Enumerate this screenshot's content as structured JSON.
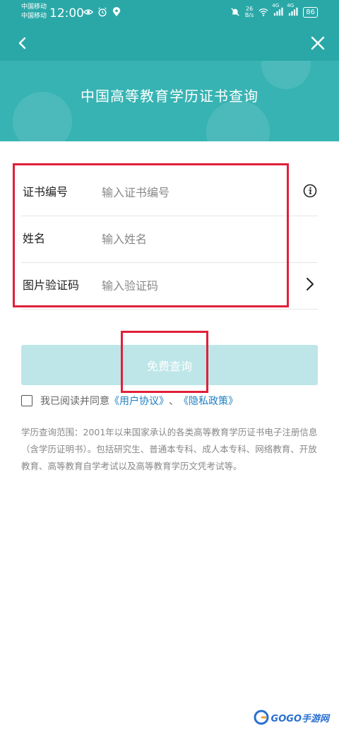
{
  "status_bar": {
    "carrier_1": "中国移动",
    "carrier_2": "中国移动",
    "time": "12:00",
    "net_speed_value": "26",
    "net_speed_unit": "B/s",
    "signal_1_label": "4G",
    "signal_2_label": "4G",
    "battery": "86"
  },
  "header": {
    "title": "中国高等教育学历证书查询"
  },
  "form": {
    "fields": [
      {
        "label": "证书编号",
        "placeholder": "输入证书编号"
      },
      {
        "label": "姓名",
        "placeholder": "输入姓名"
      },
      {
        "label": "图片验证码",
        "placeholder": "输入验证码"
      }
    ]
  },
  "query_button": {
    "label": "免费查询"
  },
  "agreement": {
    "prefix": "我已阅读并同意",
    "user_agreement": "《用户协议》",
    "separator": "、",
    "privacy_policy": "《隐私政策》",
    "checked": false
  },
  "description": "学历查询范围：2001年以来国家承认的各类高等教育学历证书电子注册信息（含学历证明书）。包括研究生、普通本专科、成人本专科、网络教育、开放教育、高等教育自学考试以及高等教育学历文凭考试等。",
  "watermark": {
    "text": "GOGO手游网"
  },
  "colors": {
    "header_teal": "#2aa8a8",
    "button_disabled": "#bee6e8",
    "link_blue": "#1e7fc2",
    "annotation_red": "#e0203a"
  },
  "icons": [
    "chevron-left-icon",
    "close-icon",
    "info-icon",
    "chevron-right-icon",
    "eye-icon",
    "alarm-icon",
    "location-icon",
    "mute-icon",
    "wifi-icon",
    "signal-icon",
    "battery-icon"
  ]
}
